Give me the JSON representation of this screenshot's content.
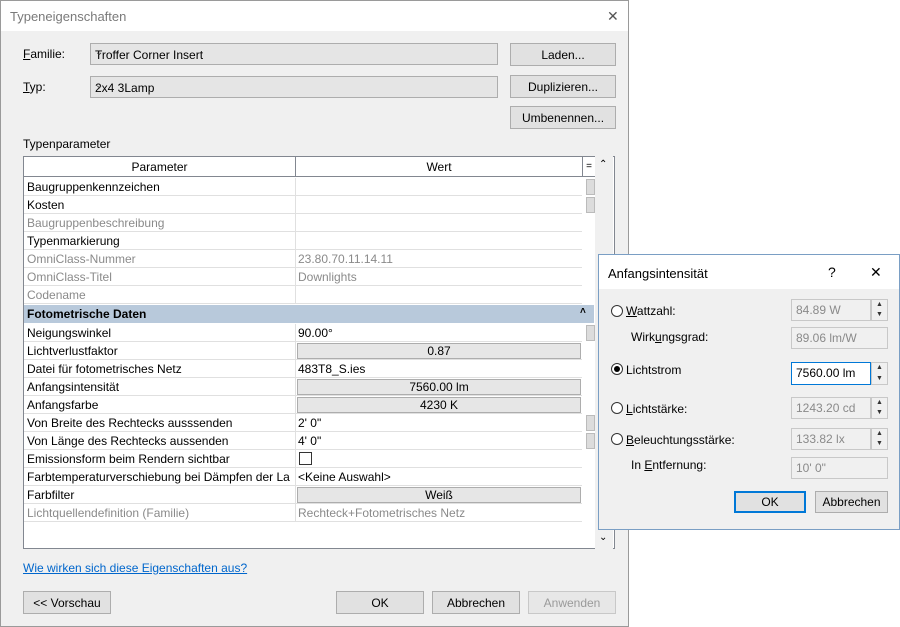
{
  "main_dialog": {
    "title": "Typeneigenschaften",
    "close_glyph": "✕",
    "familie_label": "Familie:",
    "familie_value": "Troffer Corner Insert",
    "typ_label": "Typ:",
    "typ_value": "2x4 3Lamp",
    "laden_label": "Laden...",
    "duplizieren_label": "Duplizieren...",
    "umbenennen_label": "Umbenennen...",
    "typenparameter_label": "Typenparameter",
    "col_parameter": "Parameter",
    "col_wert": "Wert",
    "rows_top": [
      {
        "name": "Baugruppenkennzeichen",
        "value": "",
        "dim": false
      },
      {
        "name": "Kosten",
        "value": "",
        "dim": false
      },
      {
        "name": "Baugruppenbeschreibung",
        "value": "",
        "dim": true
      },
      {
        "name": "Typenmarkierung",
        "value": "",
        "dim": false
      },
      {
        "name": "OmniClass-Nummer",
        "value": "23.80.70.11.14.11",
        "dim": true
      },
      {
        "name": "OmniClass-Titel",
        "value": "Downlights",
        "dim": true
      },
      {
        "name": "Codename",
        "value": "",
        "dim": true
      }
    ],
    "group_title": "Fotometrische Daten",
    "rows_photo": [
      {
        "name": "Neigungswinkel",
        "value": "90.00°",
        "kind": "text"
      },
      {
        "name": "Lichtverlustfaktor",
        "value": "0.87",
        "kind": "button"
      },
      {
        "name": "Datei für fotometrisches Netz",
        "value": "483T8_S.ies",
        "kind": "text"
      },
      {
        "name": "Anfangsintensität",
        "value": "7560.00 lm",
        "kind": "button"
      },
      {
        "name": "Anfangsfarbe",
        "value": "4230 K",
        "kind": "button"
      },
      {
        "name": "Von Breite des Rechtecks ausssenden",
        "value": "2'  0\"",
        "kind": "text"
      },
      {
        "name": "Von Länge des Rechtecks aussenden",
        "value": "4'  0\"",
        "kind": "text"
      },
      {
        "name": "Emissionsform beim Rendern sichtbar",
        "value": "",
        "kind": "checkbox"
      },
      {
        "name": "Farbtemperaturverschiebung bei Dämpfen der La",
        "value": "<Keine Auswahl>",
        "kind": "text"
      },
      {
        "name": "Farbfilter",
        "value": "Weiß",
        "kind": "button"
      },
      {
        "name": "Lichtquellendefinition (Familie)",
        "value": "Rechteck+Fotometrisches Netz",
        "kind": "dim"
      }
    ],
    "help_link": "Wie wirken sich diese Eigenschaften aus?",
    "vorschau_label": "<< Vorschau",
    "ok_label": "OK",
    "abbrechen_label": "Abbrechen",
    "anwenden_label": "Anwenden"
  },
  "sub_dialog": {
    "title": "Anfangsintensität",
    "help_glyph": "?",
    "close_glyph": "✕",
    "wattzahl_label": "Wattzahl:",
    "wattzahl_value": "84.89 W",
    "wirkungsgrad_label": "Wirkungsgrad:",
    "wirkungsgrad_value": "89.06 lm/W",
    "lichtstrom_label": "Lichtstrom",
    "lichtstrom_value": "7560.00 lm",
    "lichtstaerke_label": "Lichtstärke:",
    "lichtstaerke_value": "1243.20 cd",
    "beleuchtung_label": "Beleuchtungsstärke:",
    "beleuchtung_value": "133.82 lx",
    "entfernung_label": "In Entfernung:",
    "entfernung_value": "10'  0\"",
    "ok_label": "OK",
    "abbrechen_label": "Abbrechen",
    "selected_option": "Lichtstrom"
  }
}
